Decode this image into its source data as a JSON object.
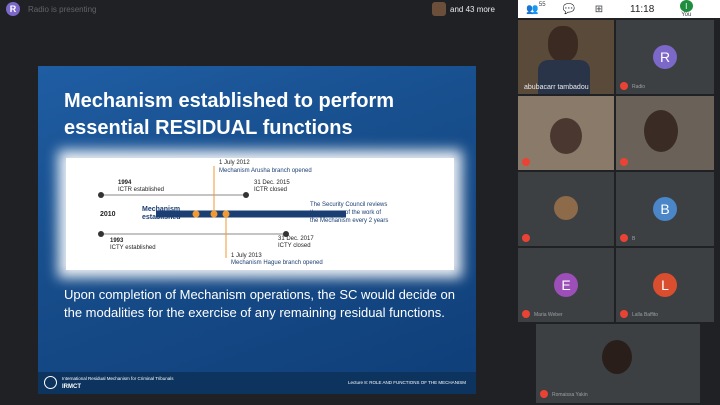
{
  "topbar": {
    "presenter_initial": "R",
    "presenting_text": "Radio is presenting",
    "more_participants": "and 43 more",
    "people_count": "55",
    "time": "11:18",
    "you_initial": "I",
    "you_label": "You"
  },
  "slide": {
    "title_line1": "Mechanism established to perform",
    "title_line2": "essential RESIDUAL functions",
    "timeline": {
      "july2012_date": "1 July 2012",
      "july2012_text": "Mechanism Arusha branch opened",
      "y1994": "1994",
      "ictr_est": "ICTR established",
      "dec2015_date": "31 Dec. 2015",
      "ictr_closed": "ICTR closed",
      "y2010": "2010",
      "mechanism_label": "Mechanism",
      "established_label": "established",
      "sc_line1": "The Security Council reviews",
      "sc_line2": "the progress of the work of",
      "sc_line3": "the Mechanism every 2 years",
      "y1993": "1993",
      "icty_est": "ICTY established",
      "dec2017_date": "31 Dec. 2017",
      "icty_closed": "ICTY closed",
      "july2013_date": "1 July 2013",
      "july2013_text": "Mechanism Hague branch opened"
    },
    "body": "Upon completion of Mechanism operations, the SC would decide on the modalities for the exercise of any remaining residual functions.",
    "footer_org": "International Residual Mechanism for Criminal Tribunals",
    "footer_abbr": "IRMCT",
    "footer_right": "Lecture 8: ROLE AND FUNCTIONS OF THE MECHANISM"
  },
  "participants": [
    {
      "name": "abubacarr tambadou"
    },
    {
      "name": "Radio",
      "initial": "R",
      "color": "#7b68c8"
    },
    {
      "name": ""
    },
    {
      "name": ""
    },
    {
      "name": ""
    },
    {
      "name": "B",
      "initial": "B",
      "color": "#4a86c8"
    },
    {
      "name": "Maria Weber",
      "initial": "E",
      "color": "#9c4fb8"
    },
    {
      "name": "Lalla Baffito",
      "initial": "L",
      "color": "#d94e2f"
    },
    {
      "name": "Romaissa Yakin"
    }
  ],
  "colors": {
    "meet_bg": "#202124",
    "tile_bg": "#3c4043",
    "slide_blue": "#1f5da3",
    "accent_orange": "#f29a31",
    "mic_red": "#ea4335"
  }
}
